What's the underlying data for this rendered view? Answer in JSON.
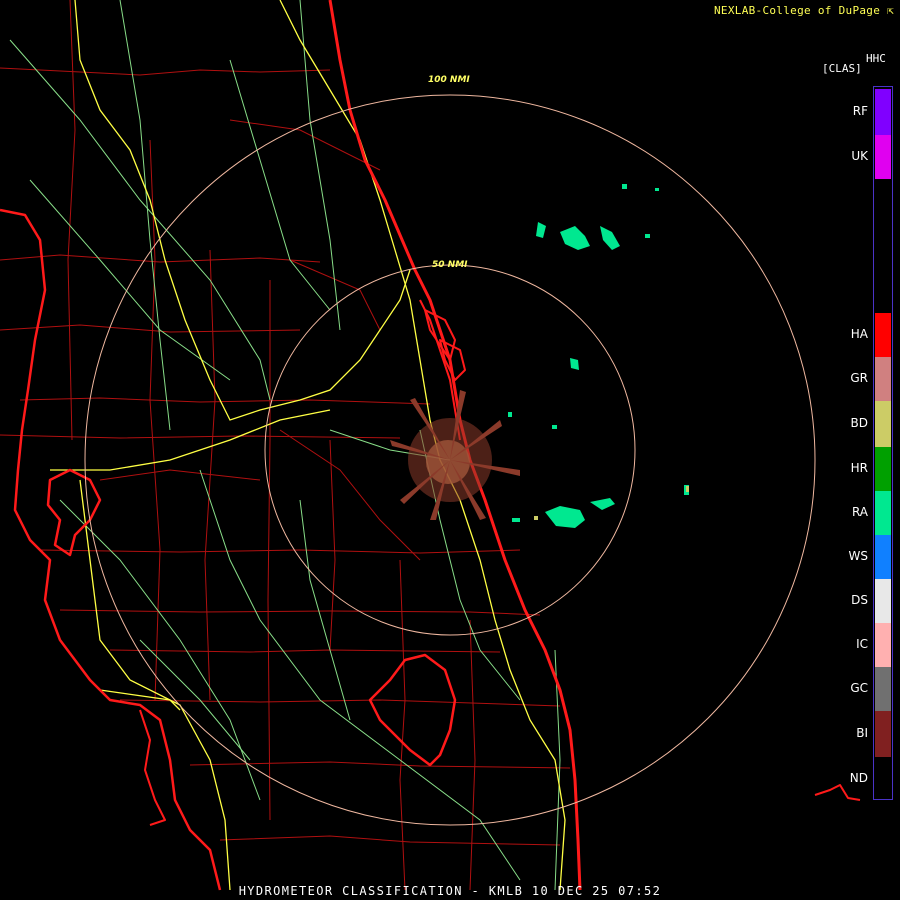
{
  "header": {
    "credit": "NEXLAB-College of DuPage ⇱"
  },
  "legend": {
    "title_top": "HHC",
    "title_bottom": "[CLAS]",
    "classes": [
      {
        "code": "RF",
        "color": "#8000ff"
      },
      {
        "code": "UK",
        "color": "#e000f0"
      },
      {
        "code": "HA",
        "color": "#ff0000"
      },
      {
        "code": "GR",
        "color": "#d08080"
      },
      {
        "code": "BD",
        "color": "#cccc66"
      },
      {
        "code": "HR",
        "color": "#00a000"
      },
      {
        "code": "RA",
        "color": "#00e890"
      },
      {
        "code": "WS",
        "color": "#1080ff"
      },
      {
        "code": "DS",
        "color": "#e8e8e8"
      },
      {
        "code": "IC",
        "color": "#ffb0b0"
      },
      {
        "code": "GC",
        "color": "#707070"
      },
      {
        "code": "BI",
        "color": "#802020"
      },
      {
        "code": "ND",
        "color": "#3a20a8"
      }
    ]
  },
  "rings": [
    {
      "label": "100 NMI",
      "range_nmi": 100
    },
    {
      "label": "50 NMI",
      "range_nmi": 50
    }
  ],
  "map_colors": {
    "coast": "#ff1a1a",
    "county": "#b01010",
    "interstate": "#ffff44",
    "highway": "#88dd88",
    "ring": "#f0b8a0"
  },
  "footer": {
    "caption": "HYDROMETEOR CLASSIFICATION - KMLB 10 DEC 25 07:52"
  }
}
